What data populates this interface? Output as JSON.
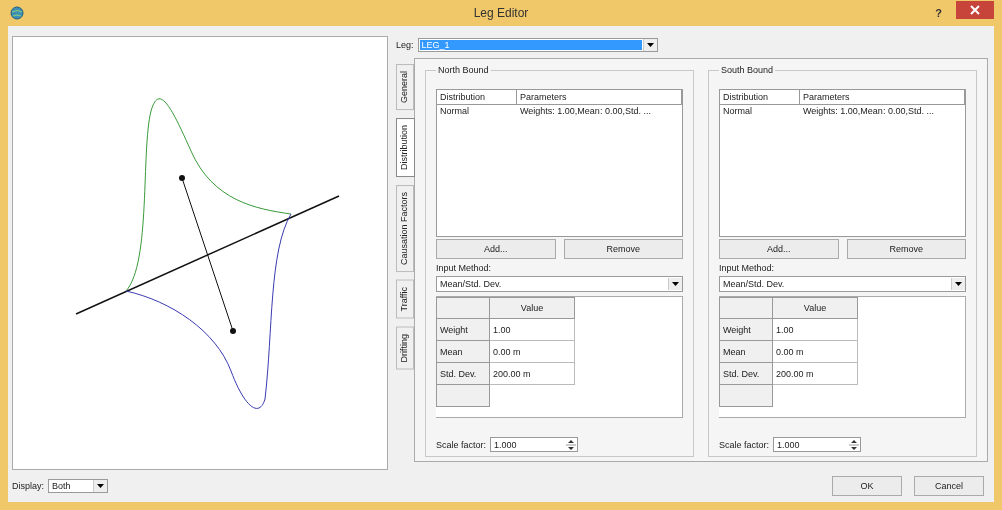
{
  "window": {
    "title": "Leg Editor",
    "help": "?"
  },
  "leg": {
    "label": "Leg:",
    "value": "LEG_1"
  },
  "tabs": [
    {
      "label": "General",
      "selected": false
    },
    {
      "label": "Distribution",
      "selected": true
    },
    {
      "label": "Causation Factors",
      "selected": false
    },
    {
      "label": "Traffic",
      "selected": false
    },
    {
      "label": "Drifting",
      "selected": false
    }
  ],
  "groups": [
    {
      "title": "North Bound",
      "list": {
        "columns": [
          "Distribution",
          "Parameters"
        ],
        "rows": [
          [
            "Normal",
            "Weights: 1.00,Mean: 0.00,Std. ..."
          ]
        ]
      },
      "buttons": [
        "Add...",
        "Remove"
      ],
      "input_method": {
        "label": "Input Method:",
        "value": "Mean/Std. Dev."
      },
      "grid": {
        "column": "Value",
        "rows": [
          {
            "label": "Weight",
            "value": "1.00"
          },
          {
            "label": "Mean",
            "value": "0.00 m"
          },
          {
            "label": "Std. Dev.",
            "value": "200.00 m"
          }
        ]
      },
      "scale": {
        "label": "Scale factor:",
        "value": "1.000"
      }
    },
    {
      "title": "South Bound",
      "list": {
        "columns": [
          "Distribution",
          "Parameters"
        ],
        "rows": [
          [
            "Normal",
            "Weights: 1.00,Mean: 0.00,Std. ..."
          ]
        ]
      },
      "buttons": [
        "Add...",
        "Remove"
      ],
      "input_method": {
        "label": "Input Method:",
        "value": "Mean/Std. Dev."
      },
      "grid": {
        "column": "Value",
        "rows": [
          {
            "label": "Weight",
            "value": "1.00"
          },
          {
            "label": "Mean",
            "value": "0.00 m"
          },
          {
            "label": "Std. Dev.",
            "value": "200.00 m"
          }
        ]
      },
      "scale": {
        "label": "Scale factor:",
        "value": "1.000"
      }
    }
  ],
  "display": {
    "label": "Display:",
    "value": "Both"
  },
  "buttons": [
    "OK",
    "Cancel"
  ]
}
